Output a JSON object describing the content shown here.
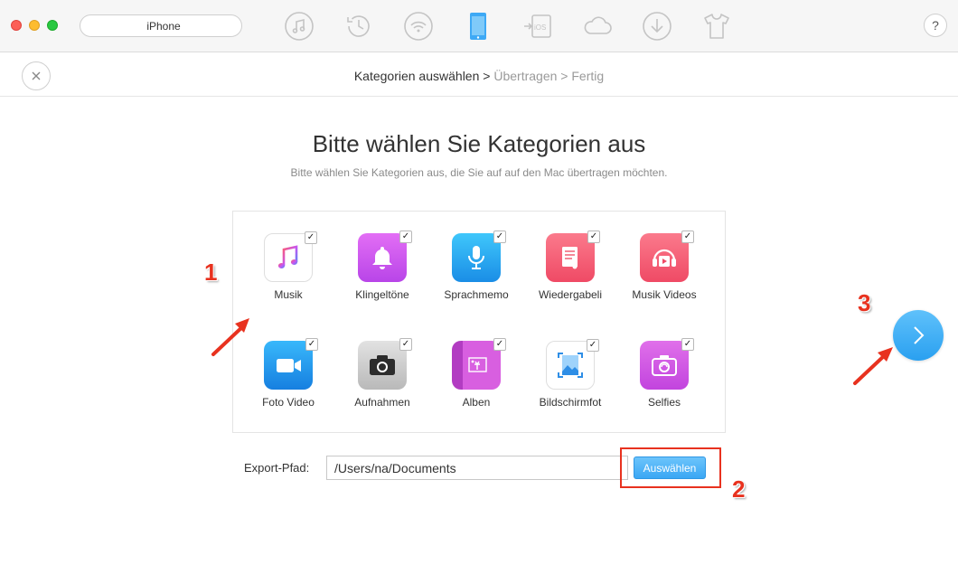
{
  "toolbar": {
    "device_name": "iPhone",
    "icons": [
      "music-icon",
      "history-icon",
      "wifi-sync-icon",
      "iphone-icon",
      "ios-transfer-icon",
      "cloud-icon",
      "download-icon",
      "tshirt-icon"
    ],
    "help_label": "?"
  },
  "breadcrumb": {
    "step1": "Kategorien auswählen",
    "sep1": " > ",
    "step2": "Übertragen",
    "sep2": " > ",
    "step3": "Fertig"
  },
  "page": {
    "title": "Bitte wählen Sie Kategorien aus",
    "subtitle": "Bitte wählen Sie Kategorien aus, die Sie auf auf den Mac übertragen möchten."
  },
  "categories": [
    {
      "label": "Musik",
      "icon": "music-note-icon",
      "checked": true
    },
    {
      "label": "Klingeltöne",
      "icon": "bell-icon",
      "checked": true
    },
    {
      "label": "Sprachmemo",
      "icon": "microphone-icon",
      "checked": true
    },
    {
      "label": "Wiedergabeli",
      "icon": "playlist-icon",
      "checked": true
    },
    {
      "label": "Musik Videos",
      "icon": "music-video-icon",
      "checked": true
    },
    {
      "label": "Foto Video",
      "icon": "video-camera-icon",
      "checked": true
    },
    {
      "label": "Aufnahmen",
      "icon": "camera-icon",
      "checked": true
    },
    {
      "label": "Alben",
      "icon": "album-icon",
      "checked": true
    },
    {
      "label": "Bildschirmfot",
      "icon": "screenshot-icon",
      "checked": true
    },
    {
      "label": "Selfies",
      "icon": "selfie-camera-icon",
      "checked": true
    }
  ],
  "check_mark": "✓",
  "export": {
    "label": "Export-Pfad:",
    "path": "/Users/na/Documents",
    "choose_label": "Auswählen"
  },
  "annotations": {
    "n1": "1",
    "n2": "2",
    "n3": "3"
  },
  "colors": {
    "accent": "#2aa0f0",
    "annotation_red": "#e8321f"
  }
}
